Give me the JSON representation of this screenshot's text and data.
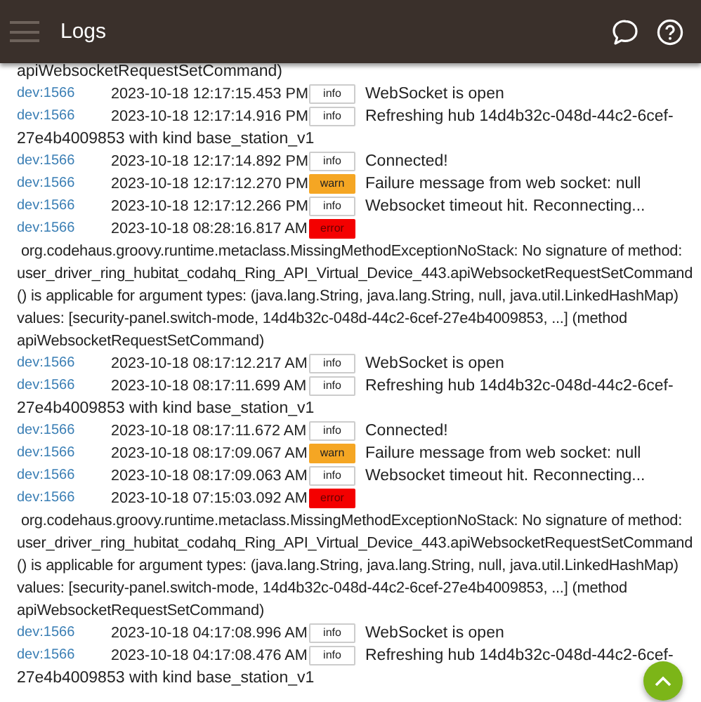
{
  "app_bar": {
    "title": "Logs"
  },
  "top_fragment": "apiWebsocketRequestSetCommand)",
  "entries": [
    {
      "source": "dev:1566",
      "time": "2023-10-18 12:17:15.453 PM",
      "kind": "info",
      "badge": "info",
      "message": "WebSocket is open"
    },
    {
      "source": "dev:1566",
      "time": "2023-10-18 12:17:14.916 PM",
      "kind": "info",
      "badge": "info",
      "message": "Refreshing hub 14d4b32c-048d-44c2-6cef-",
      "message_continued": "27e4b4009853 with kind base_station_v1"
    },
    {
      "source": "dev:1566",
      "time": "2023-10-18 12:17:14.892 PM",
      "kind": "info",
      "badge": "info",
      "message": "Connected!"
    },
    {
      "source": "dev:1566",
      "time": "2023-10-18 12:17:12.270 PM",
      "kind": "warn",
      "badge": "warn",
      "message": "Failure message from web socket: null"
    },
    {
      "source": "dev:1566",
      "time": "2023-10-18 12:17:12.266 PM",
      "kind": "info",
      "badge": "info",
      "message": "Websocket timeout hit. Reconnecting..."
    },
    {
      "source": "dev:1566",
      "time": "2023-10-18 08:28:16.817 AM",
      "kind": "error",
      "badge": "error",
      "message": " org.codehaus.groovy.runtime.metaclass.MissingMethodExceptionNoStack: No signature of method: user_driver_ring_hubitat_codahq_Ring_API_Virtual_Device_443.apiWebsocketRequestSetCommand() is applicable for argument types: (java.lang.String, java.lang.String, null, java.util.LinkedHashMap) values: [security-panel.switch-mode, 14d4b32c-048d-44c2-6cef-27e4b4009853, ...] (method apiWebsocketRequestSetCommand)"
    },
    {
      "source": "dev:1566",
      "time": "2023-10-18 08:17:12.217 AM",
      "kind": "info",
      "badge": "info",
      "message": "WebSocket is open"
    },
    {
      "source": "dev:1566",
      "time": "2023-10-18 08:17:11.699 AM",
      "kind": "info",
      "badge": "info",
      "message": "Refreshing hub 14d4b32c-048d-44c2-6cef-",
      "message_continued": "27e4b4009853 with kind base_station_v1"
    },
    {
      "source": "dev:1566",
      "time": "2023-10-18 08:17:11.672 AM",
      "kind": "info",
      "badge": "info",
      "message": "Connected!"
    },
    {
      "source": "dev:1566",
      "time": "2023-10-18 08:17:09.067 AM",
      "kind": "warn",
      "badge": "warn",
      "message": "Failure message from web socket: null"
    },
    {
      "source": "dev:1566",
      "time": "2023-10-18 08:17:09.063 AM",
      "kind": "info",
      "badge": "info",
      "message": "Websocket timeout hit. Reconnecting..."
    },
    {
      "source": "dev:1566",
      "time": "2023-10-18 07:15:03.092 AM",
      "kind": "error",
      "badge": "error",
      "message": " org.codehaus.groovy.runtime.metaclass.MissingMethodExceptionNoStack: No signature of method: user_driver_ring_hubitat_codahq_Ring_API_Virtual_Device_443.apiWebsocketRequestSetCommand() is applicable for argument types: (java.lang.String, java.lang.String, null, java.util.LinkedHashMap) values: [security-panel.switch-mode, 14d4b32c-048d-44c2-6cef-27e4b4009853, ...] (method apiWebsocketRequestSetCommand)"
    },
    {
      "source": "dev:1566",
      "time": "2023-10-18 04:17:08.996 AM",
      "kind": "info",
      "badge": "info",
      "message": "WebSocket is open"
    },
    {
      "source": "dev:1566",
      "time": "2023-10-18 04:17:08.476 AM",
      "kind": "info",
      "badge": "info",
      "message": "Refreshing hub 14d4b32c-048d-44c2-6cef-",
      "message_continued": "27e4b4009853 with kind base_station_v1"
    }
  ]
}
